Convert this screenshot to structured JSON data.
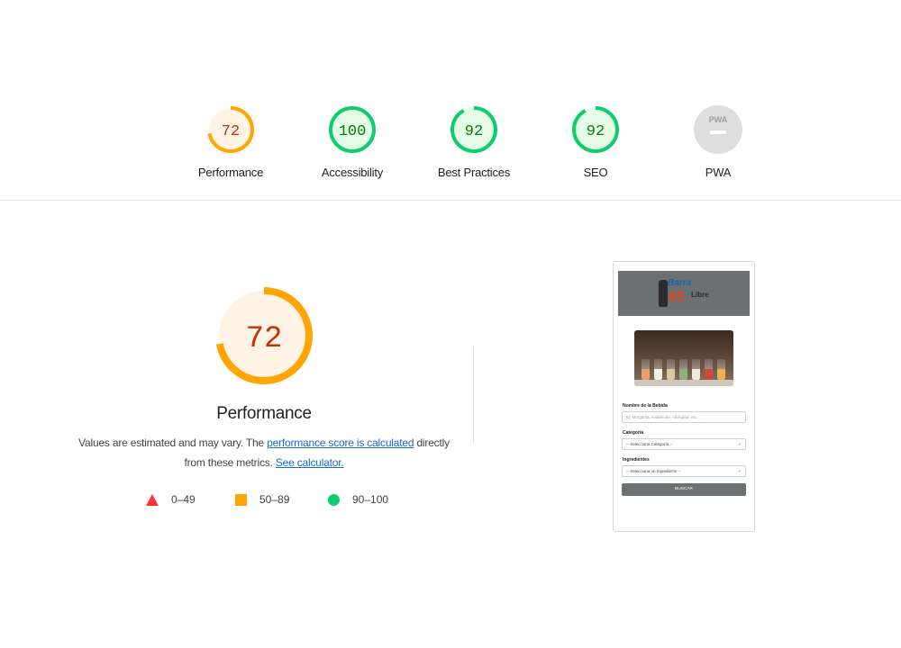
{
  "categories": [
    {
      "score": "72",
      "label": "Performance",
      "score_value": 72,
      "color": "#fa7d00",
      "ring": "#ffa400",
      "fill": "#fff3e6"
    },
    {
      "score": "100",
      "label": "Accessibility",
      "score_value": 100,
      "color": "#008000",
      "ring": "#0cce6b",
      "fill": "#e6fae8"
    },
    {
      "score": "92",
      "label": "Best Practices",
      "score_value": 92,
      "color": "#008000",
      "ring": "#0cce6b",
      "fill": "#e6fae8"
    },
    {
      "score": "92",
      "label": "SEO",
      "score_value": 92,
      "color": "#008000",
      "ring": "#0cce6b",
      "fill": "#e6fae8"
    },
    {
      "score": "PWA",
      "label": "PWA",
      "color": "#9e9e9e",
      "fill": "#dedede"
    }
  ],
  "performance": {
    "score": "72",
    "score_value": 72,
    "title": "Performance",
    "desc_prefix": "Values are estimated and may vary. The ",
    "link_score": "performance score is calculated",
    "desc_middle": " directly from these metrics. ",
    "link_calc": "See calculator."
  },
  "legend": [
    {
      "range": "0–49",
      "shape": "triangle",
      "color": "#ff3333"
    },
    {
      "range": "50–89",
      "shape": "square",
      "color": "#ffa400"
    },
    {
      "range": "90–100",
      "shape": "circle",
      "color": "#0cce6b"
    }
  ],
  "screenshot": {
    "logo_word1": "Barra",
    "logo_number": "45",
    "logo_word2": "Libre",
    "field1_label": "Nombre de la Bebida",
    "field1_placeholder": "Ej: Margarita, Avalanche, Afterglow, etc...",
    "field2_label": "Categoría",
    "field2_value": "-- Selecciona Categoría --",
    "field3_label": "Ingredientes",
    "field3_value": "-- Selecciona un Ingrediente --",
    "button_label": "BUSCAR"
  }
}
